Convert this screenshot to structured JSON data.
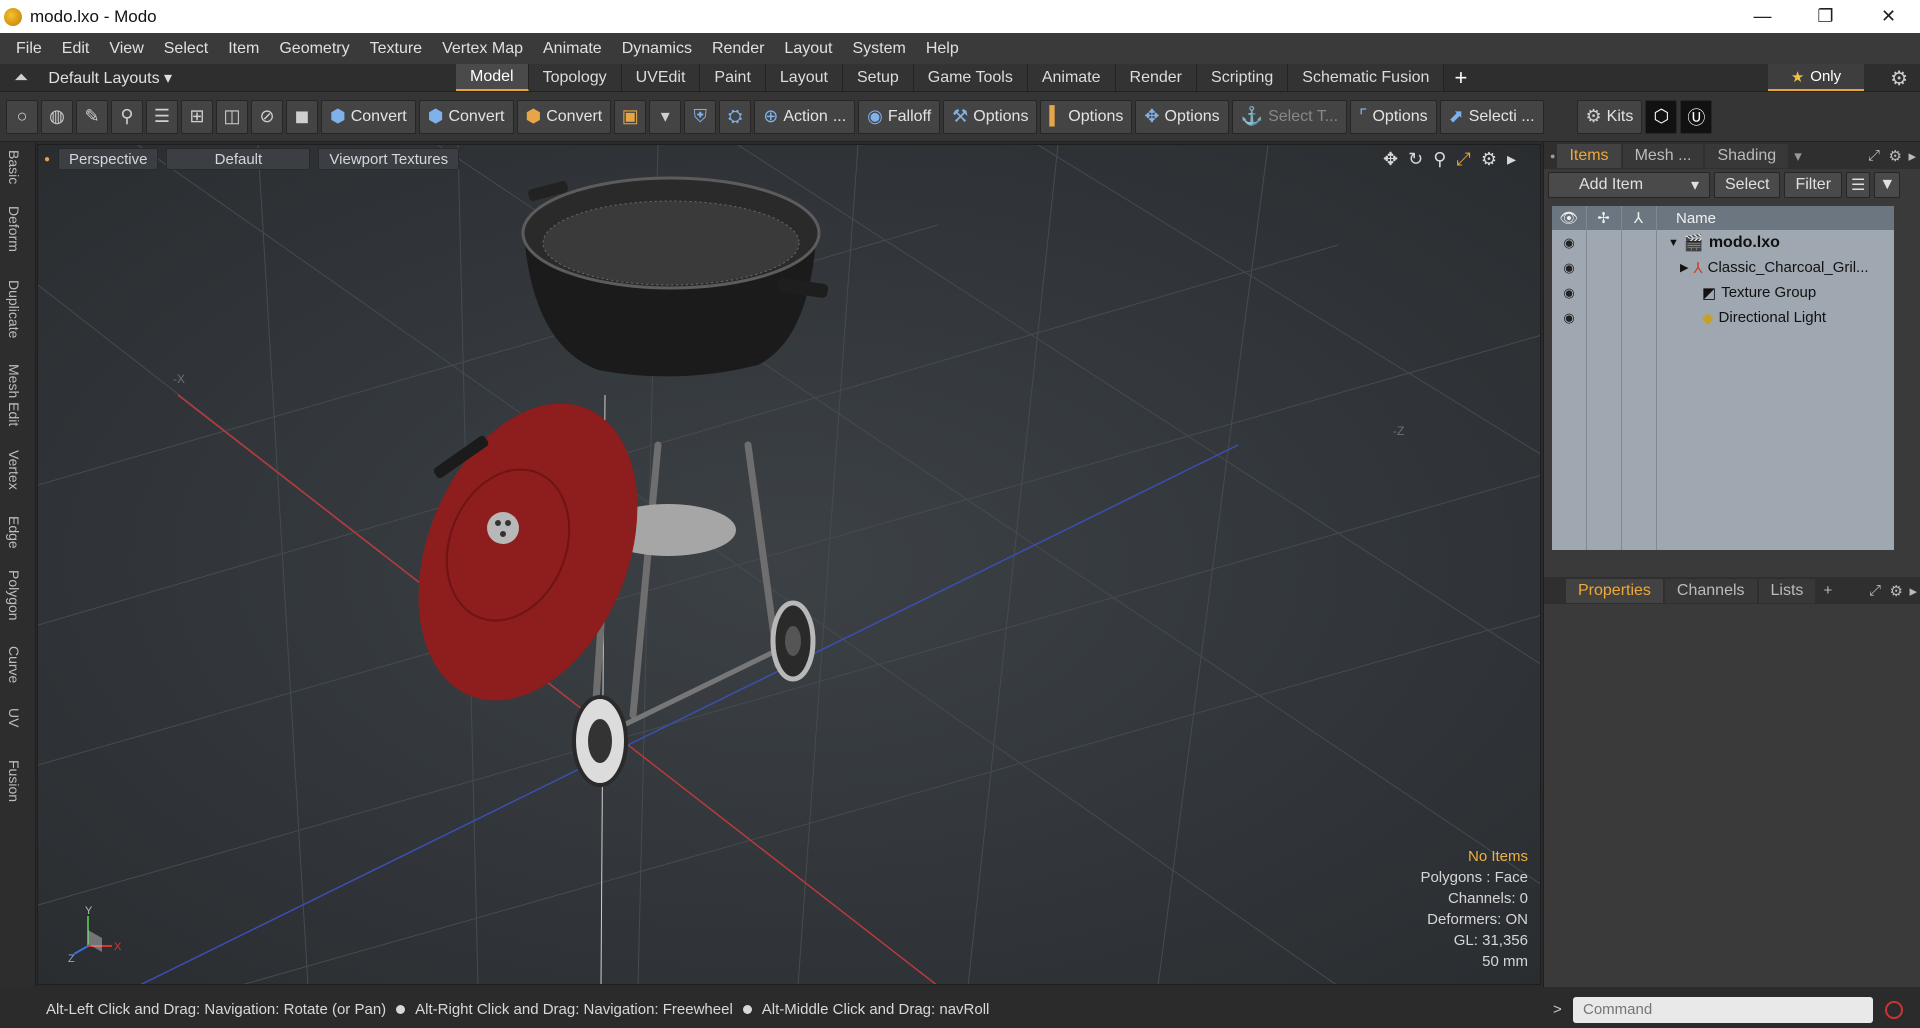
{
  "window": {
    "title": "modo.lxo - Modo",
    "minimize": "—",
    "maximize": "❐",
    "close": "✕"
  },
  "menu": [
    "File",
    "Edit",
    "View",
    "Select",
    "Item",
    "Geometry",
    "Texture",
    "Vertex Map",
    "Animate",
    "Dynamics",
    "Render",
    "Layout",
    "System",
    "Help"
  ],
  "layouts": {
    "label": "Default Layouts ▾",
    "tabs": [
      "Model",
      "Topology",
      "UVEdit",
      "Paint",
      "Layout",
      "Setup",
      "Game Tools",
      "Animate",
      "Render",
      "Scripting",
      "Schematic Fusion"
    ],
    "active_tab": "Model",
    "only_label": "Only"
  },
  "toolbar": {
    "convert1": "Convert",
    "convert2": "Convert",
    "convert3": "Convert",
    "action": "Action",
    "action_more": "...",
    "falloff": "Falloff",
    "options1": "Options",
    "options2": "Options",
    "options3": "Options",
    "select_t": "Select T...",
    "options4": "Options",
    "selecti": "Selecti ...",
    "kits": "Kits"
  },
  "left_tabs": [
    "Basic",
    "Deform",
    "Duplicate",
    "Mesh Edit",
    "Vertex",
    "Edge",
    "Polygon",
    "Curve",
    "UV",
    "Fusion"
  ],
  "viewport": {
    "perspective": "Perspective",
    "default": "Default",
    "textures": "Viewport Textures",
    "axis_labels": {
      "neg_x": "-X",
      "neg_z": "-Z"
    },
    "stats": {
      "no_items": "No Items",
      "polygons": "Polygons : Face",
      "channels": "Channels: 0",
      "deformers": "Deformers: ON",
      "gl": "GL: 31,356",
      "focal": "50 mm"
    },
    "gizmo": {
      "x": "X",
      "y": "Y",
      "z": "Z"
    }
  },
  "items_panel": {
    "tabs": [
      "Items",
      "Mesh ...",
      "Shading"
    ],
    "add_item": "Add Item",
    "select": "Select",
    "filter": "Filter",
    "name_header": "Name",
    "rows": [
      {
        "label": "modo.lxo"
      },
      {
        "label": "Classic_Charcoal_Gril..."
      },
      {
        "label": "Texture Group"
      },
      {
        "label": "Directional Light"
      }
    ]
  },
  "props_panel": {
    "tabs": [
      "Properties",
      "Channels",
      "Lists"
    ],
    "plus": "+"
  },
  "status": {
    "hint1": "Alt-Left Click and Drag: Navigation: Rotate (or Pan)",
    "hint2": "Alt-Right Click and Drag: Navigation: Freewheel",
    "hint3": "Alt-Middle Click and Drag: navRoll"
  },
  "command": {
    "placeholder": "Command",
    "prompt": ">"
  },
  "colors": {
    "accent": "#e8a33a",
    "grill_lid": "#8e1d1d",
    "grill_body": "#1a1a1a"
  }
}
